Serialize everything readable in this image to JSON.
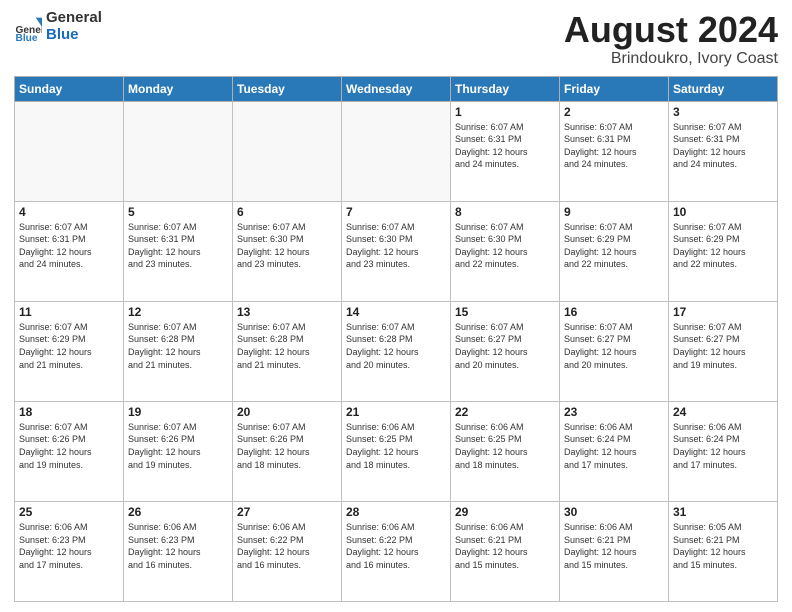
{
  "logo": {
    "general": "General",
    "blue": "Blue"
  },
  "title": "August 2024",
  "subtitle": "Brindoukro, Ivory Coast",
  "days_of_week": [
    "Sunday",
    "Monday",
    "Tuesday",
    "Wednesday",
    "Thursday",
    "Friday",
    "Saturday"
  ],
  "weeks": [
    [
      {
        "day": "",
        "info": ""
      },
      {
        "day": "",
        "info": ""
      },
      {
        "day": "",
        "info": ""
      },
      {
        "day": "",
        "info": ""
      },
      {
        "day": "1",
        "info": "Sunrise: 6:07 AM\nSunset: 6:31 PM\nDaylight: 12 hours\nand 24 minutes."
      },
      {
        "day": "2",
        "info": "Sunrise: 6:07 AM\nSunset: 6:31 PM\nDaylight: 12 hours\nand 24 minutes."
      },
      {
        "day": "3",
        "info": "Sunrise: 6:07 AM\nSunset: 6:31 PM\nDaylight: 12 hours\nand 24 minutes."
      }
    ],
    [
      {
        "day": "4",
        "info": "Sunrise: 6:07 AM\nSunset: 6:31 PM\nDaylight: 12 hours\nand 24 minutes."
      },
      {
        "day": "5",
        "info": "Sunrise: 6:07 AM\nSunset: 6:31 PM\nDaylight: 12 hours\nand 23 minutes."
      },
      {
        "day": "6",
        "info": "Sunrise: 6:07 AM\nSunset: 6:30 PM\nDaylight: 12 hours\nand 23 minutes."
      },
      {
        "day": "7",
        "info": "Sunrise: 6:07 AM\nSunset: 6:30 PM\nDaylight: 12 hours\nand 23 minutes."
      },
      {
        "day": "8",
        "info": "Sunrise: 6:07 AM\nSunset: 6:30 PM\nDaylight: 12 hours\nand 22 minutes."
      },
      {
        "day": "9",
        "info": "Sunrise: 6:07 AM\nSunset: 6:29 PM\nDaylight: 12 hours\nand 22 minutes."
      },
      {
        "day": "10",
        "info": "Sunrise: 6:07 AM\nSunset: 6:29 PM\nDaylight: 12 hours\nand 22 minutes."
      }
    ],
    [
      {
        "day": "11",
        "info": "Sunrise: 6:07 AM\nSunset: 6:29 PM\nDaylight: 12 hours\nand 21 minutes."
      },
      {
        "day": "12",
        "info": "Sunrise: 6:07 AM\nSunset: 6:28 PM\nDaylight: 12 hours\nand 21 minutes."
      },
      {
        "day": "13",
        "info": "Sunrise: 6:07 AM\nSunset: 6:28 PM\nDaylight: 12 hours\nand 21 minutes."
      },
      {
        "day": "14",
        "info": "Sunrise: 6:07 AM\nSunset: 6:28 PM\nDaylight: 12 hours\nand 20 minutes."
      },
      {
        "day": "15",
        "info": "Sunrise: 6:07 AM\nSunset: 6:27 PM\nDaylight: 12 hours\nand 20 minutes."
      },
      {
        "day": "16",
        "info": "Sunrise: 6:07 AM\nSunset: 6:27 PM\nDaylight: 12 hours\nand 20 minutes."
      },
      {
        "day": "17",
        "info": "Sunrise: 6:07 AM\nSunset: 6:27 PM\nDaylight: 12 hours\nand 19 minutes."
      }
    ],
    [
      {
        "day": "18",
        "info": "Sunrise: 6:07 AM\nSunset: 6:26 PM\nDaylight: 12 hours\nand 19 minutes."
      },
      {
        "day": "19",
        "info": "Sunrise: 6:07 AM\nSunset: 6:26 PM\nDaylight: 12 hours\nand 19 minutes."
      },
      {
        "day": "20",
        "info": "Sunrise: 6:07 AM\nSunset: 6:26 PM\nDaylight: 12 hours\nand 18 minutes."
      },
      {
        "day": "21",
        "info": "Sunrise: 6:06 AM\nSunset: 6:25 PM\nDaylight: 12 hours\nand 18 minutes."
      },
      {
        "day": "22",
        "info": "Sunrise: 6:06 AM\nSunset: 6:25 PM\nDaylight: 12 hours\nand 18 minutes."
      },
      {
        "day": "23",
        "info": "Sunrise: 6:06 AM\nSunset: 6:24 PM\nDaylight: 12 hours\nand 17 minutes."
      },
      {
        "day": "24",
        "info": "Sunrise: 6:06 AM\nSunset: 6:24 PM\nDaylight: 12 hours\nand 17 minutes."
      }
    ],
    [
      {
        "day": "25",
        "info": "Sunrise: 6:06 AM\nSunset: 6:23 PM\nDaylight: 12 hours\nand 17 minutes."
      },
      {
        "day": "26",
        "info": "Sunrise: 6:06 AM\nSunset: 6:23 PM\nDaylight: 12 hours\nand 16 minutes."
      },
      {
        "day": "27",
        "info": "Sunrise: 6:06 AM\nSunset: 6:22 PM\nDaylight: 12 hours\nand 16 minutes."
      },
      {
        "day": "28",
        "info": "Sunrise: 6:06 AM\nSunset: 6:22 PM\nDaylight: 12 hours\nand 16 minutes."
      },
      {
        "day": "29",
        "info": "Sunrise: 6:06 AM\nSunset: 6:21 PM\nDaylight: 12 hours\nand 15 minutes."
      },
      {
        "day": "30",
        "info": "Sunrise: 6:06 AM\nSunset: 6:21 PM\nDaylight: 12 hours\nand 15 minutes."
      },
      {
        "day": "31",
        "info": "Sunrise: 6:05 AM\nSunset: 6:21 PM\nDaylight: 12 hours\nand 15 minutes."
      }
    ]
  ]
}
